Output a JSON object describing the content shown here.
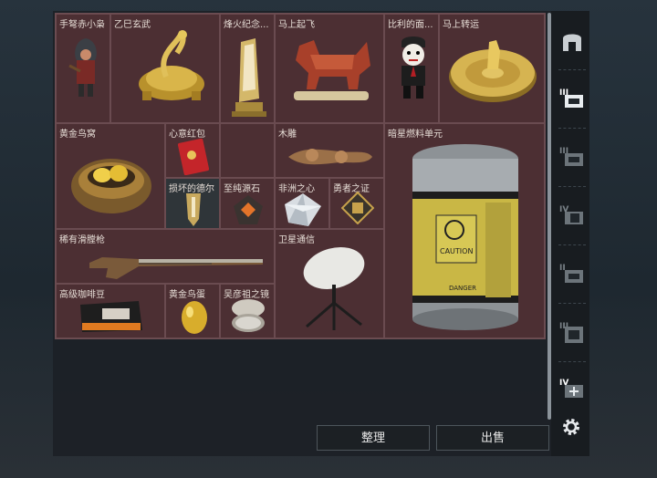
{
  "items": [
    {
      "id": "crossbow",
      "label": "手弩赤小枭"
    },
    {
      "id": "xuanwu",
      "label": "乙巳玄武"
    },
    {
      "id": "beacon",
      "label": "烽火纪念..."
    },
    {
      "id": "horse",
      "label": "马上起飞"
    },
    {
      "id": "puppet",
      "label": "比利的面..."
    },
    {
      "id": "wheel",
      "label": "马上转运"
    },
    {
      "id": "nest",
      "label": "黄金鸟窝"
    },
    {
      "id": "redpacket",
      "label": "心意红包"
    },
    {
      "id": "woodcarve",
      "label": "木雕"
    },
    {
      "id": "fuelcell",
      "label": "暗星燃料单元"
    },
    {
      "id": "damaged",
      "label": "损坏的德尔"
    },
    {
      "id": "purestone",
      "label": "至纯源石"
    },
    {
      "id": "heart",
      "label": "非洲之心"
    },
    {
      "id": "brave",
      "label": "勇者之证"
    },
    {
      "id": "musket",
      "label": "稀有滑膛枪"
    },
    {
      "id": "satellite",
      "label": "卫星通信"
    },
    {
      "id": "coffee",
      "label": "高级咖啡豆"
    },
    {
      "id": "egg",
      "label": "黄金鸟蛋"
    },
    {
      "id": "mirror",
      "label": "吴彦祖之镜"
    }
  ],
  "fuelcell_text": {
    "caution": "CAUTION",
    "danger": "DANGER"
  },
  "buttons": {
    "sort": "整理",
    "sell": "出售"
  },
  "tabs": [
    "tier-3-items-tab",
    "tier-3-items-tab-2",
    "tier-4-items-tab",
    "tier-2-items-tab",
    "tier-3-items-tab-3",
    "tier-4-items-tab-2"
  ],
  "tab_numerals": [
    "III",
    "III",
    "IV",
    "II",
    "III",
    "IV"
  ]
}
